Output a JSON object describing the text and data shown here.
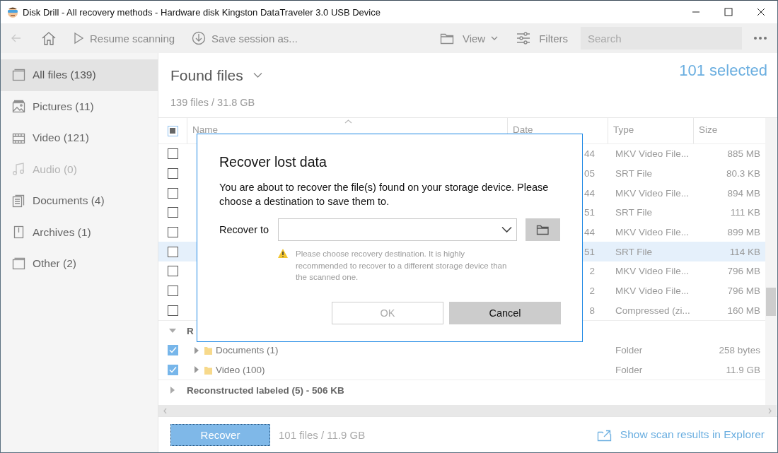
{
  "window": {
    "title": "Disk Drill - All recovery methods - Hardware disk Kingston DataTraveler 3.0 USB Device"
  },
  "toolbar": {
    "resume": "Resume scanning",
    "save": "Save session as...",
    "view": "View",
    "filters": "Filters",
    "search": {
      "placeholder": "Search"
    }
  },
  "sidebar": {
    "items": [
      {
        "label": "All files (139)",
        "selected": true,
        "disabled": false
      },
      {
        "label": "Pictures (11)",
        "selected": false,
        "disabled": false
      },
      {
        "label": "Video (121)",
        "selected": false,
        "disabled": false
      },
      {
        "label": "Audio (0)",
        "selected": false,
        "disabled": true
      },
      {
        "label": "Documents (4)",
        "selected": false,
        "disabled": false
      },
      {
        "label": "Archives (1)",
        "selected": false,
        "disabled": false
      },
      {
        "label": "Other (2)",
        "selected": false,
        "disabled": false
      }
    ]
  },
  "header": {
    "title": "Found files",
    "summary": "139 files / 31.8 GB",
    "selection": "101 selected"
  },
  "table": {
    "columns": [
      "Name",
      "Date",
      "Type",
      "Size"
    ],
    "header_indeterminate": true,
    "rows": [
      {
        "date": "44",
        "type": "MKV Video File...",
        "size": "885 MB",
        "checked": false,
        "selected": false
      },
      {
        "date": "05",
        "type": "SRT File",
        "size": "80.3 KB",
        "checked": false,
        "selected": false
      },
      {
        "date": "44",
        "type": "MKV Video File...",
        "size": "894 MB",
        "checked": false,
        "selected": false
      },
      {
        "date": "51",
        "type": "SRT File",
        "size": "111 KB",
        "checked": false,
        "selected": false
      },
      {
        "date": "44",
        "type": "MKV Video File...",
        "size": "899 MB",
        "checked": false,
        "selected": false
      },
      {
        "date": "51",
        "type": "SRT File",
        "size": "114 KB",
        "checked": false,
        "selected": true
      },
      {
        "date": "2",
        "type": "MKV Video File...",
        "size": "796 MB",
        "checked": false,
        "selected": false
      },
      {
        "date": "2",
        "type": "MKV Video File...",
        "size": "796 MB",
        "checked": false,
        "selected": false
      },
      {
        "date": "8",
        "type": "Compressed (zi...",
        "size": "160 MB",
        "checked": false,
        "selected": false
      }
    ],
    "groups": [
      {
        "label": "R",
        "expanded": true,
        "children": [
          {
            "name": "Documents (1)",
            "type": "Folder",
            "size": "258 bytes",
            "checked": true,
            "expanded": false
          },
          {
            "name": "Video (100)",
            "type": "Folder",
            "size": "11.9 GB",
            "checked": true,
            "expanded": false
          }
        ]
      },
      {
        "label": "Reconstructed labeled (5) - 506 KB",
        "expanded": false
      }
    ]
  },
  "dialog": {
    "title": "Recover lost data",
    "message": "You are about to recover the file(s) found on your storage device. Please choose a destination to save them to.",
    "field_label": "Recover to",
    "warning": "Please choose recovery destination. It is highly recommended to recover to a different storage device than the scanned one.",
    "buttons": [
      {
        "label": "OK",
        "disabled": true
      },
      {
        "label": "Cancel",
        "disabled": false
      }
    ]
  },
  "footer": {
    "recover": "Recover",
    "selection": "101 files / 11.9 GB",
    "link": "Show scan results in Explorer"
  }
}
